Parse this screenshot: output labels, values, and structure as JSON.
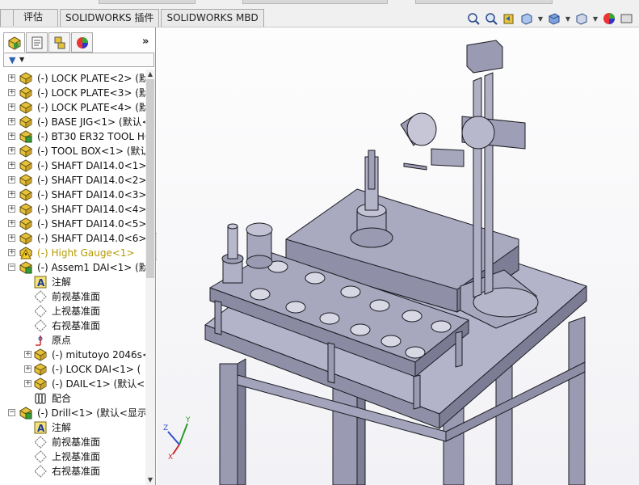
{
  "command_tabs": [
    {
      "label": "评估"
    },
    {
      "label": "SOLIDWORKS 插件"
    },
    {
      "label": "SOLIDWORKS MBD"
    }
  ],
  "view_tools": [
    "zoom-to-fit-icon",
    "zoom-area-icon",
    "previous-view-icon",
    "section-view-icon",
    "view-orientation-icon",
    "display-style-icon",
    "hide-show-icon",
    "appearance-icon",
    "scene-icon"
  ],
  "panel": {
    "tabs": [
      "feature-manager-icon",
      "property-manager-icon",
      "configuration-manager-icon",
      "display-manager-icon"
    ],
    "more_label": "»"
  },
  "tree": {
    "items": [
      {
        "label": "(-) LOCK PLATE<2> (默",
        "level": 0,
        "expander": "+",
        "icon": "part"
      },
      {
        "label": "(-) LOCK PLATE<3> (默",
        "level": 0,
        "expander": "+",
        "icon": "part"
      },
      {
        "label": "(-) LOCK PLATE<4> (默",
        "level": 0,
        "expander": "+",
        "icon": "part"
      },
      {
        "label": "(-) BASE JIG<1> (默认<",
        "level": 0,
        "expander": "+",
        "icon": "part"
      },
      {
        "label": "(-) BT30 ER32 TOOL HO",
        "level": 0,
        "expander": "+",
        "icon": "assembly"
      },
      {
        "label": "(-) TOOL BOX<1> (默认",
        "level": 0,
        "expander": "+",
        "icon": "part"
      },
      {
        "label": "(-) SHAFT DAI14.0<1>",
        "level": 0,
        "expander": "+",
        "icon": "part"
      },
      {
        "label": "(-) SHAFT DAI14.0<2>",
        "level": 0,
        "expander": "+",
        "icon": "part"
      },
      {
        "label": "(-) SHAFT DAI14.0<3>",
        "level": 0,
        "expander": "+",
        "icon": "part"
      },
      {
        "label": "(-) SHAFT DAI14.0<4>",
        "level": 0,
        "expander": "+",
        "icon": "part"
      },
      {
        "label": "(-) SHAFT DAI14.0<5>",
        "level": 0,
        "expander": "+",
        "icon": "part"
      },
      {
        "label": "(-) SHAFT DAI14.0<6>",
        "level": 0,
        "expander": "+",
        "icon": "part"
      },
      {
        "label": "(-) Hight Gauge<1>",
        "level": 0,
        "expander": "+",
        "icon": "warning",
        "warn": true
      },
      {
        "label": "(-) Assem1 DAI<1> (默",
        "level": 0,
        "expander": "-",
        "icon": "assembly"
      },
      {
        "label": "注解",
        "level": 1,
        "expander": "",
        "icon": "annotation"
      },
      {
        "label": "前视基准面",
        "level": 1,
        "expander": "",
        "icon": "plane"
      },
      {
        "label": "上视基准面",
        "level": 1,
        "expander": "",
        "icon": "plane"
      },
      {
        "label": "右视基准面",
        "level": 1,
        "expander": "",
        "icon": "plane"
      },
      {
        "label": "原点",
        "level": 1,
        "expander": "",
        "icon": "origin"
      },
      {
        "label": "(-) mitutoyo 2046s<",
        "level": 1,
        "expander": "+",
        "icon": "part"
      },
      {
        "label": "(-) LOCK DAI<1> (",
        "level": 1,
        "expander": "+",
        "icon": "part"
      },
      {
        "label": "(-) DAIL<1> (默认<",
        "level": 1,
        "expander": "+",
        "icon": "part"
      },
      {
        "label": "配合",
        "level": 1,
        "expander": "",
        "icon": "mates"
      },
      {
        "label": "(-) Drill<1> (默认<显示",
        "level": 0,
        "expander": "-",
        "icon": "assembly"
      },
      {
        "label": "注解",
        "level": 1,
        "expander": "",
        "icon": "annotation"
      },
      {
        "label": "前视基准面",
        "level": 1,
        "expander": "",
        "icon": "plane"
      },
      {
        "label": "上视基准面",
        "level": 1,
        "expander": "",
        "icon": "plane"
      },
      {
        "label": "右视基准面",
        "level": 1,
        "expander": "",
        "icon": "plane"
      }
    ]
  },
  "triad": {
    "x": "X",
    "y": "Y",
    "z": "Z"
  },
  "colors": {
    "model_fill": "#a9a9c0",
    "model_dark": "#8a8aa2",
    "model_edge": "#1c1c24",
    "part_icon": "#e6c23a",
    "assembly_icon": "#3a9a3a"
  }
}
